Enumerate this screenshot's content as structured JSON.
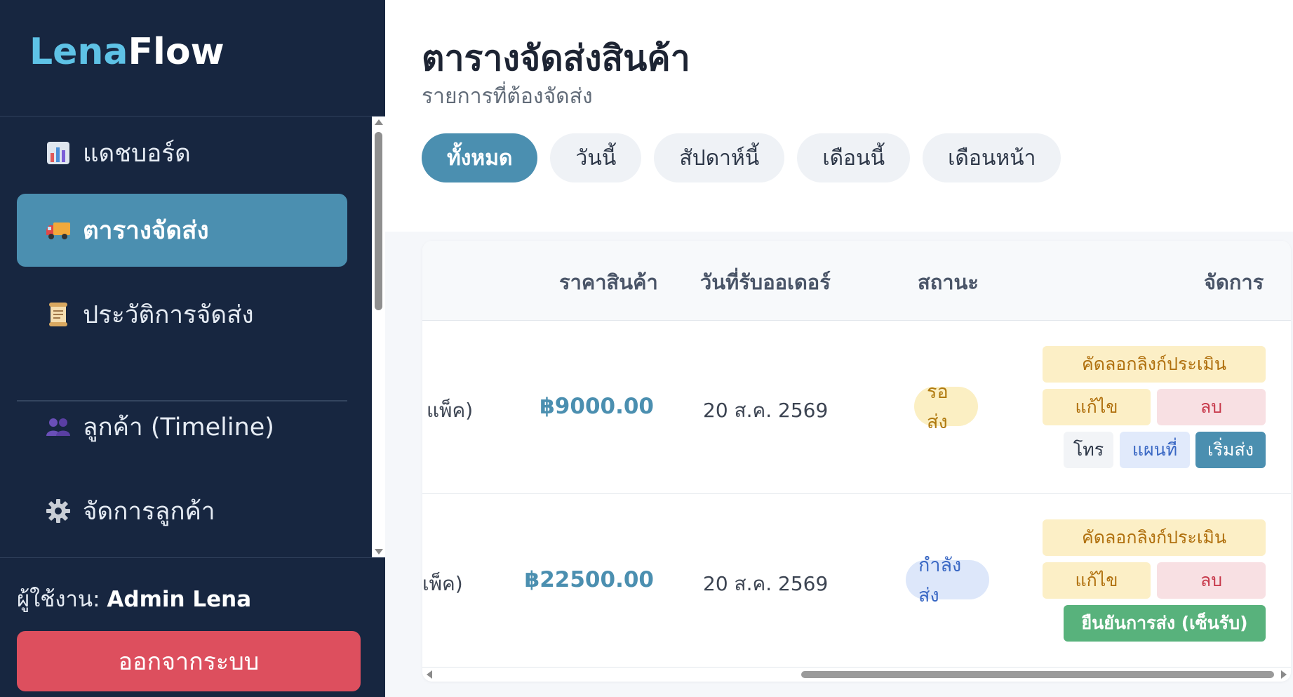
{
  "brand": {
    "part1": "Lena",
    "part2": "Flow"
  },
  "sidebar": {
    "items": [
      {
        "label": "แดชบอร์ด",
        "icon": "chart-icon"
      },
      {
        "label": "ตารางจัดส่ง",
        "icon": "truck-icon",
        "active": true
      },
      {
        "label": "ประวัติการจัดส่ง",
        "icon": "scroll-icon"
      },
      {
        "label": "ลูกค้า (Timeline)",
        "icon": "users-icon"
      },
      {
        "label": "จัดการลูกค้า",
        "icon": "gear-icon"
      }
    ],
    "user_prefix": "ผู้ใช้งาน:",
    "user_name": "Admin Lena",
    "logout_label": "ออกจากระบบ"
  },
  "header": {
    "title": "ตารางจัดส่งสินค้า",
    "subtitle": "รายการที่ต้องจัดส่ง"
  },
  "filters": [
    "ทั้งหมด",
    "วันนี้",
    "สัปดาห์นี้",
    "เดือนนี้",
    "เดือนหน้า"
  ],
  "table": {
    "columns": [
      "ราคาสินค้า",
      "วันที่รับออเดอร์",
      "สถานะ",
      "จัดการ"
    ],
    "rows": [
      {
        "product_fragment": "แพ็ค)",
        "price": "฿9000.00",
        "order_date": "20 ส.ค. 2569",
        "status": "รอส่ง",
        "actions": {
          "eval": "คัดลอกลิงก์ประเมิน",
          "edit": "แก้ไข",
          "delete": "ลบ",
          "call": "โทร",
          "map": "แผนที่",
          "start": "เริ่มส่ง"
        }
      },
      {
        "product_fragment": "เพ็ค)",
        "price": "฿22500.00",
        "order_date": "20 ส.ค. 2569",
        "status": "กำลังส่ง",
        "actions": {
          "eval": "คัดลอกลิงก์ประเมิน",
          "edit": "แก้ไข",
          "delete": "ลบ",
          "confirm": "ยืนยันการส่ง (เซ็นรับ)"
        }
      }
    ]
  },
  "colors": {
    "sidebar_bg": "#172640",
    "accent": "#4b8fb0",
    "brand_accent": "#5ec2e6",
    "logout": "#dd4f5e",
    "confirm": "#58b27c"
  }
}
